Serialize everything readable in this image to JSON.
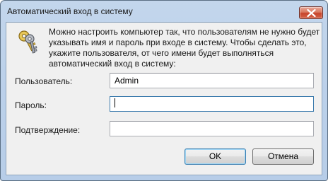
{
  "window": {
    "title": "Автоматический вход в систему",
    "close_icon": "close-icon"
  },
  "dialog": {
    "icon": "keys-icon",
    "message": "Можно настроить компьютер так, что пользователям не нужно будет указывать имя и пароль при входе в систему. Чтобы сделать это, укажите пользователя, от чего имени будет выполняться автоматический вход в систему:",
    "fields": {
      "username": {
        "label": "Пользователь:",
        "value": "Admin"
      },
      "password": {
        "label": "Пароль:",
        "value": ""
      },
      "confirm": {
        "label": "Подтверждение:",
        "value": ""
      }
    },
    "buttons": {
      "ok": "OK",
      "cancel": "Отмена"
    }
  },
  "colors": {
    "frame": "#bcd1ea",
    "client": "#f0f0f0",
    "close_button": "#c7432a",
    "default_button_border": "#3c7fb1"
  }
}
